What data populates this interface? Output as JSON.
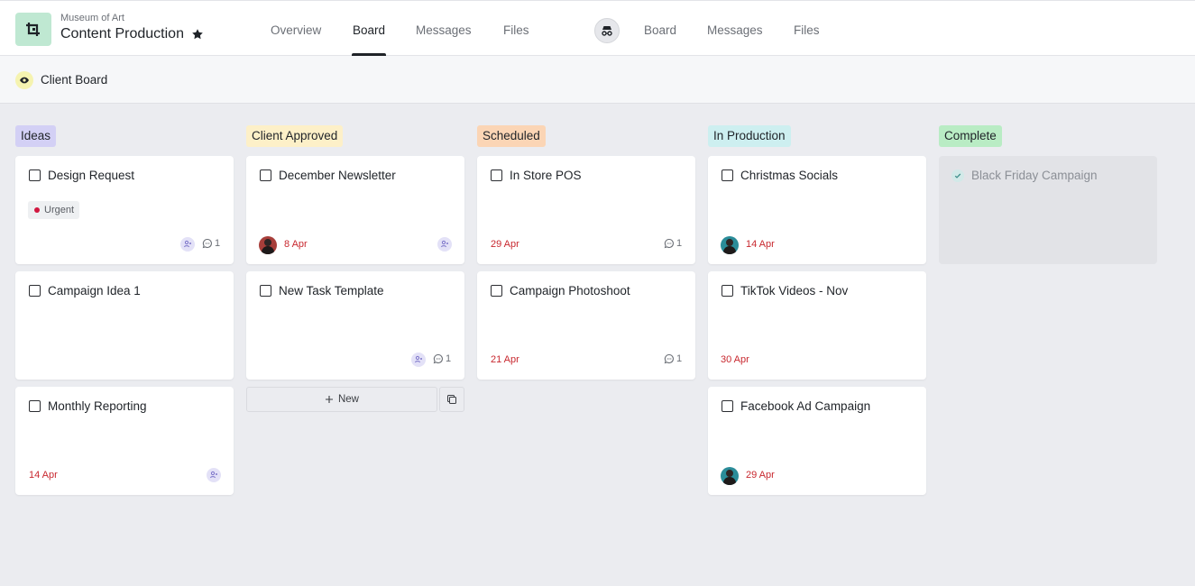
{
  "header": {
    "org_name": "Museum of Art",
    "project_name": "Content Production",
    "nav": [
      {
        "label": "Overview",
        "active": false
      },
      {
        "label": "Board",
        "active": true
      },
      {
        "label": "Messages",
        "active": false
      },
      {
        "label": "Files",
        "active": false
      }
    ],
    "guest_nav": [
      {
        "label": "Board"
      },
      {
        "label": "Messages"
      },
      {
        "label": "Files"
      }
    ]
  },
  "subheader": {
    "board_name": "Client Board"
  },
  "columns": [
    {
      "label": "Ideas",
      "color": "#d3d0f5",
      "cards": [
        {
          "title": "Design Request",
          "tag": "Urgent",
          "comments": "1"
        },
        {
          "title": "Campaign Idea 1"
        },
        {
          "title": "Monthly Reporting",
          "date": "14 Apr"
        }
      ]
    },
    {
      "label": "Client Approved",
      "color": "#fdf0c8",
      "cards": [
        {
          "title": "December Newsletter",
          "date": "8 Apr"
        },
        {
          "title": "New Task Template",
          "comments": "1"
        }
      ],
      "new_label": "New"
    },
    {
      "label": "Scheduled",
      "color": "#fbd5b5",
      "cards": [
        {
          "title": "In Store POS",
          "date": "29 Apr",
          "comments": "1"
        },
        {
          "title": "Campaign Photoshoot",
          "date": "21 Apr",
          "comments": "1"
        }
      ]
    },
    {
      "label": "In Production",
      "color": "#cdeff0",
      "cards": [
        {
          "title": "Christmas Socials",
          "date": "14 Apr"
        },
        {
          "title": "TikTok Videos - Nov",
          "date": "30 Apr"
        },
        {
          "title": "Facebook Ad Campaign",
          "date": "29 Apr"
        }
      ]
    },
    {
      "label": "Complete",
      "color": "#b9ecc4",
      "cards": [
        {
          "title": "Black Friday Campaign",
          "completed": true
        }
      ]
    }
  ],
  "icons": {
    "logo": "crop-icon",
    "favorite": "star-icon",
    "guest": "incognito-icon",
    "visibility": "eye-icon",
    "member": "member-icon",
    "comment": "comment-icon",
    "add": "plus-icon",
    "duplicate": "duplicate-icon"
  }
}
